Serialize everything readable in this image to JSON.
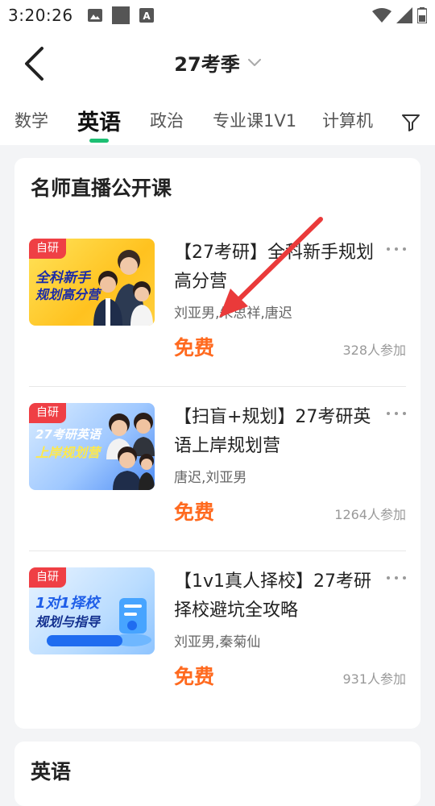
{
  "status_bar": {
    "time": "3:20:26",
    "icons": [
      "image-icon",
      "square-icon",
      "text-a-icon",
      "wifi-icon",
      "signal-icon",
      "battery-icon"
    ]
  },
  "header": {
    "title": "27考季",
    "back_icon": "chevron-left-icon",
    "dropdown_icon": "chevron-down-icon"
  },
  "tabs": [
    {
      "label": "数学",
      "active": false
    },
    {
      "label": "英语",
      "active": true
    },
    {
      "label": "政治",
      "active": false
    },
    {
      "label": "专业课1V1",
      "active": false
    },
    {
      "label": "计算机",
      "active": false
    }
  ],
  "filter_icon": "filter-icon",
  "accent_color": "#1dbf73",
  "price_color": "#ff6a1f",
  "section": {
    "title": "名师直播公开课",
    "courses": [
      {
        "badge": "自研",
        "thumb_line1": "全科新手",
        "thumb_line2": "规划高分营",
        "title": "【27考研】全科新手规划高分营",
        "teachers": "刘亚男,朱思祥,唐迟",
        "price": "免费",
        "participants": "328人参加"
      },
      {
        "badge": "自研",
        "thumb_line1": "27考研英语",
        "thumb_line2": "上岸规划营",
        "title": "【扫盲+规划】27考研英语上岸规划营",
        "teachers": "唐迟,刘亚男",
        "price": "免费",
        "participants": "1264人参加"
      },
      {
        "badge": "自研",
        "thumb_line1": "1对1择校",
        "thumb_line2": "规划与指导",
        "title": "【1v1真人择校】27考研择校避坑全攻略",
        "teachers": "刘亚男,秦菊仙",
        "price": "免费",
        "participants": "931人参加"
      }
    ]
  },
  "next_section": {
    "title": "英语"
  }
}
